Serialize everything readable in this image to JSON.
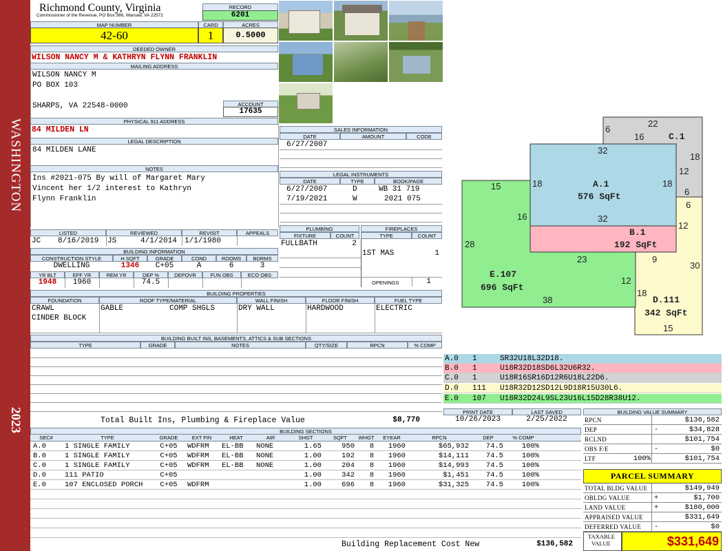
{
  "sidebar": {
    "name": "WASHINGTON",
    "year": "2023",
    "color": "#a52a2a"
  },
  "header": {
    "county": "Richmond County, Virginia",
    "commissioner": "Commissioner of the Revenue, PO Box 366, Warsaw, VA 22572",
    "record_label": "RECORD",
    "record": "6201",
    "map_label": "MAP NUMBER",
    "map": "42-60",
    "card_label": "CARD",
    "card": "1",
    "acres_label": "ACRES",
    "acres": "0.5000"
  },
  "owner": {
    "deeded_label": "DEEDED OWNER",
    "deeded": "WILSON NANCY M & KATHRYN FLYNN FRANKLIN",
    "mailing_label": "MAILING ADDRESS",
    "mail1": "WILSON NANCY M",
    "mail2": "PO BOX 103",
    "mail3": "SHARPS, VA 22548-0000",
    "account_label": "ACCOUNT",
    "account": "17635",
    "physical_label": "PHYSICAL 911 ADDRESS",
    "physical": "84 MILDEN LN",
    "legal_label": "LEGAL DESCRIPTION",
    "legal": "84 MILDEN LANE",
    "notes_label": "NOTES",
    "notes1": "Ins #2021-075 By will of Margaret Mary",
    "notes2": "Vincent her 1/2 interest to Kathryn",
    "notes3": "Flynn Franklin"
  },
  "review": {
    "listed_label": "LISTED",
    "listed_by": "JC",
    "listed_date": "8/16/2019",
    "reviewed_label": "REVIEWED",
    "reviewed_by": "JS",
    "reviewed_date": "4/1/2014",
    "revisit_label": "REVISIT",
    "revisit": "1/1/1980",
    "appeals_label": "APPEALS",
    "appeals": ""
  },
  "building_info": {
    "title": "BUILDING INFORMATION",
    "h_style": "CONSTRUCTION STYLE",
    "h_sqft": "H SQFT",
    "h_grade": "GRADE",
    "h_cond": "COND",
    "h_rooms": "ROOMS",
    "h_bdrms": "BDRMS",
    "style": "DWELLING",
    "sqft": "1346",
    "grade": "C+05",
    "cond": "A",
    "rooms": "6",
    "bdrms": "3",
    "h_yrblt": "YR BLT",
    "h_effyr": "EFF YR",
    "h_remyr": "REM YR",
    "h_dep": "DEP %",
    "h_depovr": "DEPOVR",
    "h_funobs": "FUN OBS",
    "h_ecoobs": "ECO OBS",
    "yrblt": "1948",
    "effyr": "1960",
    "remyr": "",
    "dep": "74.5",
    "depovr": "",
    "funobs": "",
    "ecoobs": ""
  },
  "properties": {
    "title": "BUILDING PROPERTIES",
    "h_foundation": "FOUNDATION",
    "h_roof": "ROOF TYPE/MATERIAL",
    "h_wall": "WALL FINISH",
    "h_floor": "FLOOR FINISH",
    "h_fuel": "FUEL TYPE",
    "foundation1": "CRAWL",
    "foundation2": "CINDER BLOCK",
    "roof_type": "GABLE",
    "roof_material": "COMP SHGLS",
    "wall": "DRY WALL",
    "floor": "HARDWOOD",
    "fuel": "ELECTRIC"
  },
  "builtins": {
    "title": "BUILDING BUILT INS, BASEMENTS, ATTICS & SUB SECTIONS",
    "h_type": "TYPE",
    "h_grade": "GRADE",
    "h_notes": "NOTES",
    "h_qty": "QTY/SIZE",
    "h_rpcn": "RPCN",
    "h_comp": "% COMP",
    "total_label": "Total Built Ins, Plumbing & Fireplace Value",
    "total": "$8,770"
  },
  "sales": {
    "title": "SALES INFORMATION",
    "h_date": "DATE",
    "h_amount": "AMOUNT",
    "h_code": "CODE",
    "rows": [
      {
        "date": "6/27/2007",
        "amount": "",
        "code": ""
      }
    ]
  },
  "legal_instruments": {
    "title": "LEGAL INSTRUMENTS",
    "h_date": "DATE",
    "h_type": "TYPE",
    "h_book": "BOOK/PAGE",
    "rows": [
      {
        "date": "6/27/2007",
        "type": "D",
        "book": "WB 31 719"
      },
      {
        "date": "7/19/2021",
        "type": "W",
        "book": "2021 075"
      }
    ]
  },
  "plumbing": {
    "title": "PLUMBING",
    "h_fixture": "FIXTURE",
    "h_count": "COUNT",
    "fixture": "FULLBATH",
    "count": "2"
  },
  "fireplaces": {
    "title": "FIREPLACES",
    "h_type": "TYPE",
    "h_count": "COUNT",
    "type": "1ST MAS",
    "count": "1",
    "openings_label": "OPENINGS",
    "openings": "1"
  },
  "sketch": {
    "a_label": "A.1",
    "a_area": "576 SqFt",
    "b_label": "B.1",
    "b_area": "192 SqFt",
    "c_label": "C.1",
    "d_label": "D.111",
    "d_area": "342 SqFt",
    "e_label": "E.107",
    "e_area": "696 SqFt",
    "dims": {
      "c_top": "22",
      "c_left": "6",
      "c_inner": "16",
      "c_right": "18",
      "c_r12": "12",
      "c_r6": "6",
      "a_top": "32",
      "a_left": "18",
      "a_right": "18",
      "a_bot": "32",
      "d_top": "6",
      "d_12": "12",
      "d_9": "9",
      "d_30": "30",
      "d_18": "18",
      "d_bot": "15",
      "e_top": "15",
      "e_16": "16",
      "e_left": "28",
      "e_23": "23",
      "e_12": "12",
      "e_bot": "38"
    },
    "colors": {
      "a": "#add8e6",
      "b": "#ffb6c1",
      "c": "#d3d3d3",
      "d": "#fffacd",
      "e": "#90ee90"
    }
  },
  "legend": [
    {
      "id": "A.0",
      "code": "1",
      "path": "SR32U18L32D18."
    },
    {
      "id": "B.0",
      "code": "1",
      "path": "U18R32D18SD6L32U6R32."
    },
    {
      "id": "C.0",
      "code": "1",
      "path": "U18R16SR16D12R6U18L22D6."
    },
    {
      "id": "D.0",
      "code": "111",
      "path": "U18R32D12SD12L9D18R15U30L6."
    },
    {
      "id": "E.0",
      "code": "107",
      "path": "U18R32D24L9SL23U16L15D28R38U12."
    }
  ],
  "dates": {
    "print_label": "PRINT DATE",
    "print": "10/26/2023",
    "saved_label": "LAST SAVED",
    "saved": "2/25/2022"
  },
  "sections": {
    "title": "BUILDING SECTIONS",
    "headers": [
      "SEC#",
      "TYPE",
      "GRADE",
      "EXT FIN",
      "HEAT",
      "AIR",
      "SHGT",
      "SQFT",
      "WHGT",
      "EYEAR",
      "RPCN",
      "DEP",
      "% COMP"
    ],
    "rows": [
      {
        "sec": "A.0",
        "type": "1 SINGLE FAMILY",
        "grade": "C+05",
        "ext": "WDFRM",
        "heat": "EL-BB",
        "air": "NONE",
        "shgt": "1.65",
        "sqft": "950",
        "whgt": "8",
        "eyear": "1960",
        "rpcn": "$65,932",
        "dep": "74.5",
        "comp": "100%"
      },
      {
        "sec": "B.0",
        "type": "1 SINGLE FAMILY",
        "grade": "C+05",
        "ext": "WDFRM",
        "heat": "EL-BB",
        "air": "NONE",
        "shgt": "1.00",
        "sqft": "192",
        "whgt": "8",
        "eyear": "1960",
        "rpcn": "$14,111",
        "dep": "74.5",
        "comp": "100%"
      },
      {
        "sec": "C.0",
        "type": "1 SINGLE FAMILY",
        "grade": "C+05",
        "ext": "WDFRM",
        "heat": "EL-BB",
        "air": "NONE",
        "shgt": "1.00",
        "sqft": "204",
        "whgt": "8",
        "eyear": "1960",
        "rpcn": "$14,993",
        "dep": "74.5",
        "comp": "100%"
      },
      {
        "sec": "D.0",
        "type": "111 PATIO",
        "grade": "C+05",
        "ext": "",
        "heat": "",
        "air": "",
        "shgt": "1.00",
        "sqft": "342",
        "whgt": "8",
        "eyear": "1960",
        "rpcn": "$1,451",
        "dep": "74.5",
        "comp": "100%"
      },
      {
        "sec": "E.0",
        "type": "107 ENCLOSED PORCH",
        "grade": "C+05",
        "ext": "WDFRM",
        "heat": "",
        "air": "",
        "shgt": "1.00",
        "sqft": "696",
        "whgt": "8",
        "eyear": "1960",
        "rpcn": "$31,325",
        "dep": "74.5",
        "comp": "100%"
      }
    ],
    "replacement_label": "Building Replacement Cost New",
    "replacement": "$136,582"
  },
  "value_summary": {
    "title": "BUILDING VALUE SUMMARY",
    "rpcn_label": "RPCN",
    "rpcn": "$136,582",
    "dep_label": "DEP",
    "dep_sign": "-",
    "dep": "$34,828",
    "rclnd_label": "RCLND",
    "rclnd": "$101,754",
    "obs_label": "OBS F/E",
    "obs_sign": "-",
    "obs": "$0",
    "ltf_label": "LTF",
    "ltf_pct": "100%",
    "ltf": "$101,754"
  },
  "parcel": {
    "title": "PARCEL SUMMARY",
    "bldg_label": "TOTAL BLDG VALUE",
    "bldg": "$149,949",
    "obldg_label": "OBLDG VALUE",
    "obldg_sign": "+",
    "obldg": "$1,700",
    "land_label": "LAND VALUE",
    "land_sign": "+",
    "land": "$180,000",
    "appraised_label": "APPRAISED VALUE",
    "appraised": "$331,649",
    "deferred_label": "DEFERRED VALUE",
    "deferred_sign": "-",
    "deferred": "$0",
    "taxable_label1": "TAXABLE",
    "taxable_label2": "VALUE",
    "taxable": "$331,649"
  }
}
